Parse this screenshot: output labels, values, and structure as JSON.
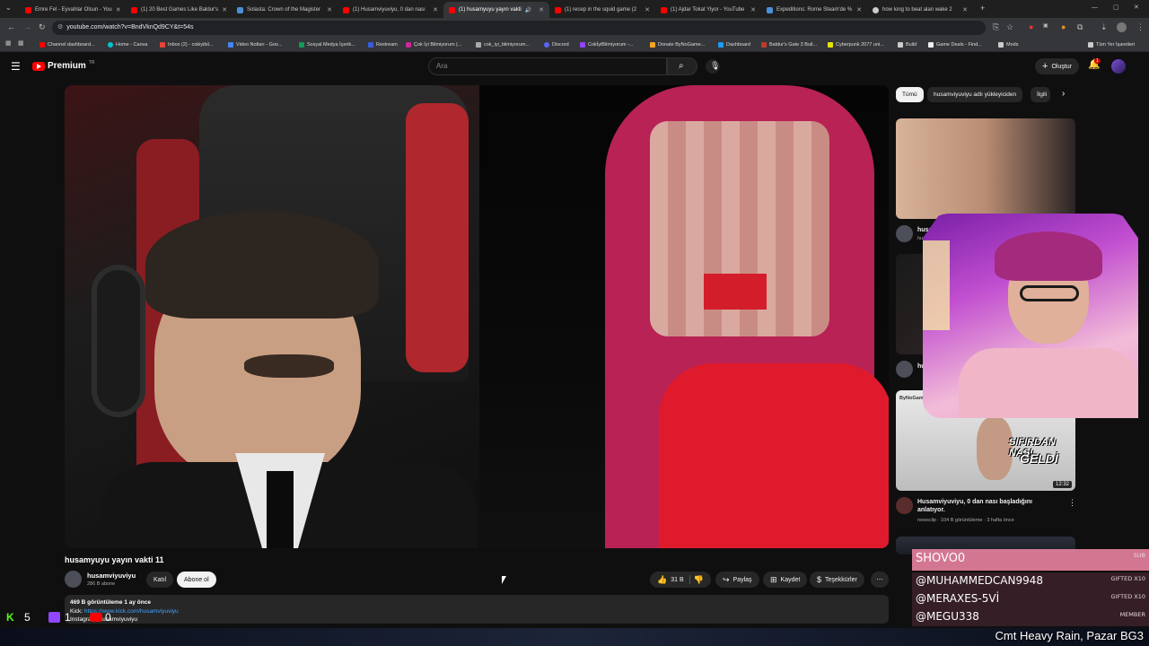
{
  "browser": {
    "tabs": [
      {
        "title": "Emre Fel - Eyvahlar Olsun - You",
        "color": "#ff0000"
      },
      {
        "title": "(1) 20 Best Games Like Baldur's",
        "color": "#ff0000"
      },
      {
        "title": "Solasta: Crown of the Magister",
        "color": "#4a90d9"
      },
      {
        "title": "(1) Husamviyuviyu, 0 dan nası",
        "color": "#ff0000"
      },
      {
        "title": "(1) husamyuyu yayın vakti",
        "color": "#ff0000"
      },
      {
        "title": "(1) recep in the squid game (2",
        "color": "#ff0000"
      },
      {
        "title": "(1) Ajdar Tokat Yiyor - YouTube",
        "color": "#ff0000"
      },
      {
        "title": "Expeditions: Rome Steam'de %",
        "color": "#4a90d9"
      },
      {
        "title": "how long to beat alan wake 2",
        "color": "#cccccc"
      }
    ],
    "url": "youtube.com/watch?v=BndVknQd9CY&t=54s",
    "bookmarks": [
      "Channel dashboard...",
      "Home - Canva",
      "Inbox (2) - cokiyibil...",
      "Video Notları - Goo...",
      "Sosyal Medya İçerik...",
      "Restream",
      "Çok İyi Bilmiyorum (...",
      "cok_iyi_bilmiyorum...",
      "Discord",
      "CokİyiBilmiyorum -...",
      "Donate ByNoGame...",
      "Dashboard",
      "Baldur's Gate 3 Buil...",
      "Cyberpunk 2077 uni...",
      "Build",
      "Game Deals - Find...",
      "Mods"
    ],
    "all_bookmarks": "Tüm Yer İşaretleri"
  },
  "header": {
    "logo": "Premium",
    "logo_sup": "TR",
    "search_placeholder": "Ara",
    "create_label": "Oluştur",
    "notif_count": "1"
  },
  "video": {
    "title": "husamyuyu yayın vakti 11",
    "channel_name": "husamviyuviyu",
    "subscribers": "286 B abone",
    "join_label": "Katıl",
    "subscribe_label": "Abone ol",
    "likes": "31 B",
    "share_label": "Paylaş",
    "save_label": "Kaydet",
    "thanks_label": "Teşekkürler",
    "views_date": "469 B görüntüleme  1 ay önce",
    "desc_kick_label": "Kick:",
    "desc_kick_link": "https://www.kick.com/husamviyuviyu",
    "desc_instagram_label": "Instagram:",
    "desc_instagram_value": "husamviyuviyu"
  },
  "sidebar": {
    "chips": [
      "Tümü",
      "husamviyuviyu adlı yükleyiciden",
      "İlgili"
    ],
    "videos": [
      {
        "channel": "husamyuyu",
        "channel_sub": "husamyu"
      },
      {
        "channel": "hu",
        "channel_sub": ""
      },
      {
        "thumb_channel": "ByNoGame",
        "thumb_caption_1": "SIFIRDAN NASI",
        "thumb_caption_2": "GELDİ",
        "duration": "12:32",
        "title": "Husamviyuviyu, 0 dan nası başladığını anlatıyor.",
        "channel": "nowsclip",
        "meta": "104 B görüntüleme · 3 hafta önce"
      }
    ]
  },
  "stream_overlay": {
    "sub_header": "SHOVO0",
    "sub_header_tag": "SUB",
    "events": [
      {
        "name": "@MUHAMMEDCAN9948",
        "tag": "GIFTED X10"
      },
      {
        "name": "@MERAXES-5Vİ",
        "tag": "GIFTED X10"
      },
      {
        "name": "@MEGU338",
        "tag": "MEMBER"
      }
    ],
    "kick_count": "5",
    "twitch_count": "1",
    "youtube_count": "0",
    "ticker": "Cmt Heavy Rain, Pazar BG3"
  },
  "colors": {
    "yt_red": "#ff0000",
    "accent": "#3ea6ff",
    "overlay_pink": "#e6598a",
    "kick_green": "#53fc18"
  }
}
